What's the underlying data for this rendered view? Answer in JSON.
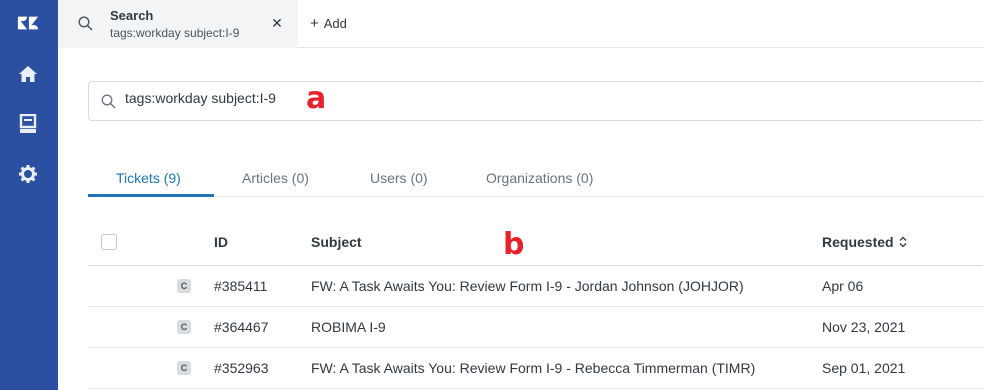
{
  "nav": {
    "items": [
      {
        "name": "logo"
      },
      {
        "name": "home"
      },
      {
        "name": "views"
      },
      {
        "name": "settings"
      }
    ]
  },
  "topbar": {
    "tab": {
      "title": "Search",
      "subtitle": "tags:workday subject:I-9"
    },
    "add_label": "Add"
  },
  "search": {
    "value": "tags:workday subject:I-9",
    "annotation": "a"
  },
  "results_tabs": [
    {
      "label": "Tickets (9)",
      "active": true
    },
    {
      "label": "Articles (0)",
      "active": false
    },
    {
      "label": "Users (0)",
      "active": false
    },
    {
      "label": "Organizations (0)",
      "active": false
    }
  ],
  "table": {
    "headers": {
      "id": "ID",
      "subject": "Subject",
      "requested": "Requested"
    },
    "annotation": "b",
    "rows": [
      {
        "badge": "C",
        "id": "#385411",
        "subject": "FW: A Task Awaits You: Review Form I-9 - Jordan Johnson (JOHJOR)",
        "requested": "Apr 06"
      },
      {
        "badge": "C",
        "id": "#364467",
        "subject": "ROBIMA I-9",
        "requested": "Nov 23, 2021"
      },
      {
        "badge": "C",
        "id": "#352963",
        "subject": "FW: A Task Awaits You: Review Form I-9 - Rebecca Timmerman (TIMR)",
        "requested": "Sep 01, 2021"
      }
    ]
  },
  "colors": {
    "nav_bg": "#2b50a1",
    "accent": "#1f73b7",
    "annotation": "#e8222b"
  }
}
